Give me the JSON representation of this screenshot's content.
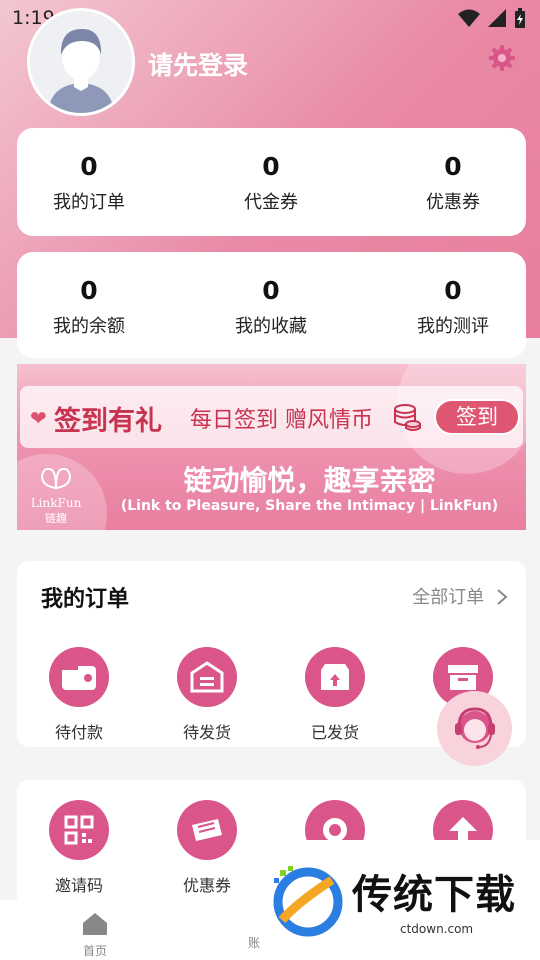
{
  "status": {
    "time": "1:19"
  },
  "profile": {
    "login_text": "请先登录"
  },
  "stats_row1": [
    {
      "value": "0",
      "label": "我的订单"
    },
    {
      "value": "0",
      "label": "代金券"
    },
    {
      "value": "0",
      "label": "优惠券"
    }
  ],
  "stats_row2": [
    {
      "value": "0",
      "label": "我的余额"
    },
    {
      "value": "0",
      "label": "我的收藏"
    },
    {
      "value": "0",
      "label": "我的测评"
    }
  ],
  "banner": {
    "signin_title": "签到有礼",
    "signin_subtitle": "每日签到 赠风情币",
    "signin_button": "签到",
    "logo_brand": "LinkFun",
    "logo_cn": "链趣",
    "slogan": "链动愉悦，趣享亲密",
    "slogan_en": "(Link to Pleasure, Share the Intimacy | LinkFun)"
  },
  "orders": {
    "title": "我的订单",
    "all_label": "全部订单",
    "items": [
      {
        "label": "待付款",
        "icon": "wallet-icon"
      },
      {
        "label": "待发货",
        "icon": "warehouse-icon"
      },
      {
        "label": "已发货",
        "icon": "box-upload-icon"
      },
      {
        "label": "",
        "icon": "archive-icon"
      }
    ]
  },
  "tools": {
    "items": [
      {
        "label": "邀请码",
        "icon": "qr-code-icon"
      },
      {
        "label": "优惠券",
        "icon": "coupon-icon"
      },
      {
        "label": "",
        "icon": "target-icon"
      },
      {
        "label": "",
        "icon": "upload-icon"
      }
    ]
  },
  "tabbar": {
    "home_label": "首页",
    "second_partial": "账"
  },
  "watermark": {
    "text": "传统下载",
    "url": "ctdown.com"
  },
  "colors": {
    "accent": "#d9558a",
    "header": "#e98aa6"
  }
}
